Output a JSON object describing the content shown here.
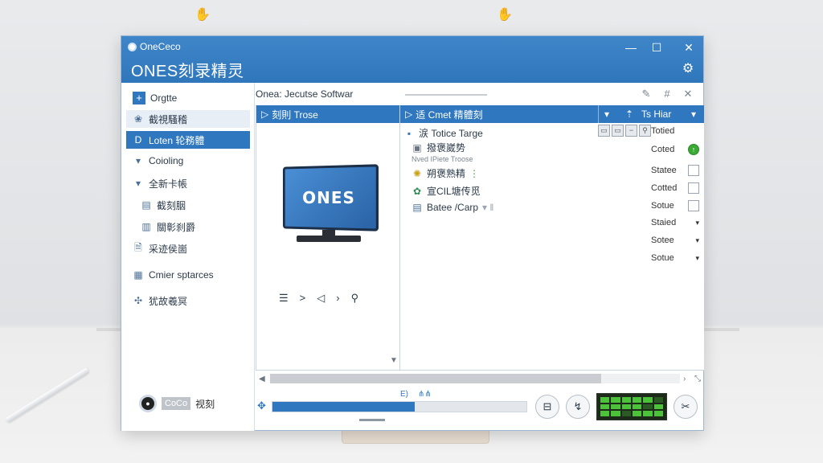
{
  "window": {
    "small_title": "OneCeco",
    "big_title": "ONES刻录精灵",
    "min": "—",
    "max": "☐",
    "close": "✕",
    "settings_icon": "gear-icon"
  },
  "sidebar": {
    "top_label": "Orgtte",
    "items": [
      {
        "label": "截視騷稽",
        "icon": "❀"
      },
      {
        "label": "Loten 轮務體",
        "icon": "D"
      },
      {
        "label": "Coioling",
        "icon": "▾"
      },
      {
        "label": "全新卡帳",
        "icon": "▾"
      },
      {
        "label": "截刻胭",
        "icon": "▤"
      },
      {
        "label": "關彰刹爵",
        "icon": "▥"
      },
      {
        "label": "采迹侯崮",
        "icon": "🗎"
      },
      {
        "label": "Cmier sptarces",
        "icon": "▦"
      },
      {
        "label": "犹故羲冥",
        "icon": "✣"
      }
    ],
    "user_badge": "CoCo",
    "user_label": "视刻"
  },
  "toolbar": {
    "path": "Onea: Jecutse Softwar"
  },
  "left_pane": {
    "header": "刻則 Trose",
    "screen_text": "ONES",
    "playback": [
      "☰",
      ">",
      "◁",
      "›",
      "⚲"
    ]
  },
  "right_pane": {
    "header_name": "适 Cmet 精體刻",
    "header_sort": "▾",
    "header_col": "Ts Hiar",
    "files": [
      {
        "label": "涙 Totice Targe",
        "icon": "▪"
      },
      {
        "label": "撥褒崴势",
        "icon": "▣"
      },
      {
        "label": "Nved IPiete Troose",
        "icon": ""
      },
      {
        "label": "朔褒熟精",
        "icon": "✺"
      },
      {
        "label": "宣CIL塘传觅",
        "icon": "✿"
      },
      {
        "label": "Batee /Carp",
        "icon": "▤"
      }
    ],
    "statuses": [
      {
        "label": "Totied",
        "mark": "none"
      },
      {
        "label": "Coted",
        "mark": "ok"
      },
      {
        "label": "Statee",
        "mark": "box"
      },
      {
        "label": "Cotted",
        "mark": "box"
      },
      {
        "label": "Sotue",
        "mark": "box"
      },
      {
        "label": "Staied",
        "mark": "caret"
      },
      {
        "label": "Sotee",
        "mark": "caret"
      },
      {
        "label": "Sotue",
        "mark": "caret"
      }
    ]
  },
  "bottom": {
    "progress": 0.56,
    "progress_label_a": "E)",
    "progress_label_b": "⋔⋔"
  }
}
